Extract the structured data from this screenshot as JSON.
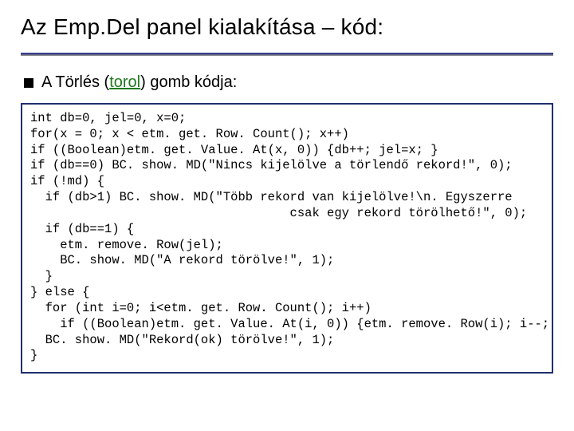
{
  "title": "Az Emp.Del panel kialakítása – kód:",
  "bullet": {
    "pre": "A Törlés (",
    "method": "torol",
    "post": ") gomb kódja:"
  },
  "code": "int db=0, jel=0, x=0;\nfor(x = 0; x < etm. get. Row. Count(); x++)\nif ((Boolean)etm. get. Value. At(x, 0)) {db++; jel=x; }\nif (db==0) BC. show. MD(\"Nincs kijelölve a törlendő rekord!\", 0);\nif (!md) {\n  if (db>1) BC. show. MD(\"Több rekord van kijelölve!\\n. Egyszerre\n                                   csak egy rekord törölhető!\", 0);\n  if (db==1) {\n    etm. remove. Row(jel);\n    BC. show. MD(\"A rekord törölve!\", 1);\n  }\n} else {\n  for (int i=0; i<etm. get. Row. Count(); i++)\n    if ((Boolean)etm. get. Value. At(i, 0)) {etm. remove. Row(i); i--; }\n  BC. show. MD(\"Rekord(ok) törölve!\", 1);\n}"
}
